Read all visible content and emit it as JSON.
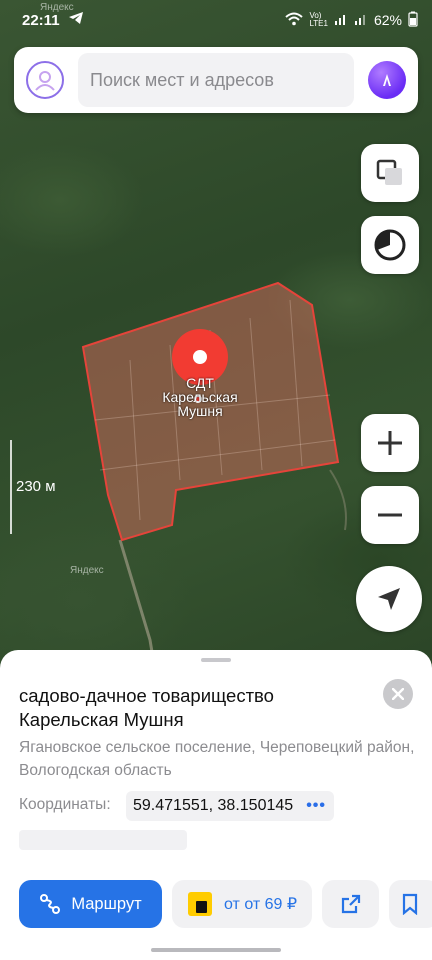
{
  "status_bar": {
    "time": "22:11",
    "battery": "62%"
  },
  "search": {
    "placeholder": "Поиск мест и адресов"
  },
  "map": {
    "watermark_top": "Яндекс",
    "watermark_bottom": "Яндекс",
    "place_label_line1": "СДТ",
    "place_label_line2": "Карельская",
    "place_label_line3": "Мушня",
    "scale_label": "230 м"
  },
  "place": {
    "title": "садово-дачное товарищество Карельская Мушня",
    "subtitle": "Ягановское сельское поселение, Череповецкий район, Вологодская область",
    "coords_label": "Координаты:",
    "coords_value": "59.471551, 38.150145"
  },
  "actions": {
    "route_label": "Маршрут",
    "taxi_label": "от от 69 ₽"
  },
  "colors": {
    "accent": "#2673e6",
    "pin": "#f23b32",
    "alice": "#6a2cf5"
  }
}
